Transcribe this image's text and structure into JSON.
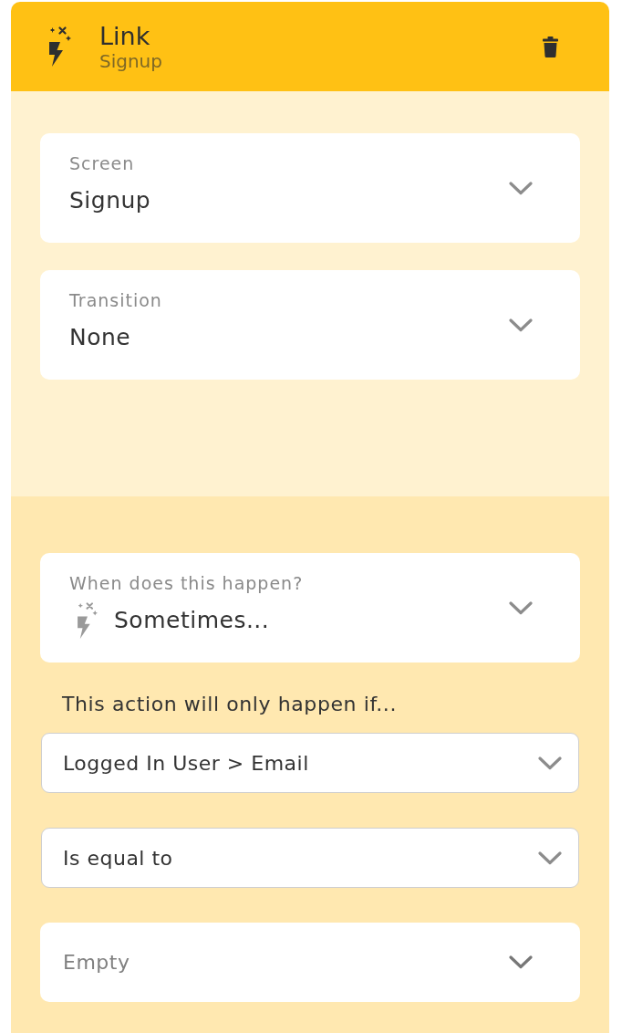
{
  "header": {
    "title": "Link",
    "subtitle": "Signup"
  },
  "settings": [
    {
      "label": "Screen",
      "value": "Signup"
    },
    {
      "label": "Transition",
      "value": "None"
    }
  ],
  "trigger": {
    "label": "When does this happen?",
    "value": "Sometimes..."
  },
  "condition": {
    "intro": "This action will only happen if...",
    "fields": [
      {
        "kind": "select",
        "value": "Logged In User > Email"
      },
      {
        "kind": "select",
        "value": "Is equal to"
      },
      {
        "kind": "input",
        "placeholder": "Empty"
      }
    ]
  }
}
